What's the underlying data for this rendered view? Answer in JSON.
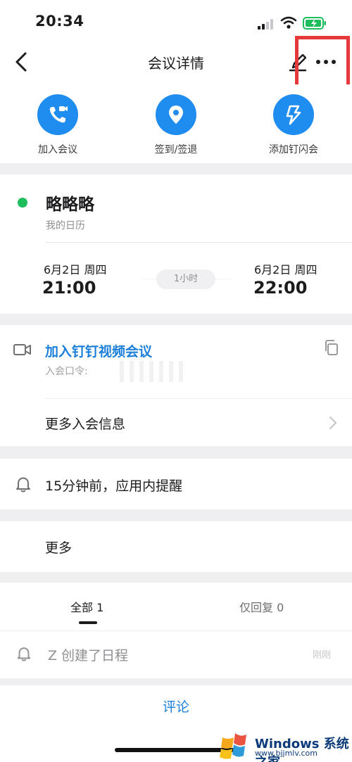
{
  "status_bar": {
    "time": "20:34"
  },
  "nav": {
    "title": "会议详情"
  },
  "actions": [
    {
      "label": "加入会议",
      "icon": "phone-video-icon"
    },
    {
      "label": "签到/签退",
      "icon": "location-pin-icon"
    },
    {
      "label": "添加钉闪会",
      "icon": "lightning-icon"
    }
  ],
  "event": {
    "title": "略略略",
    "calendar": "我的日历",
    "start_date": "6月2日 周四",
    "start_time": "21:00",
    "end_date": "6月2日 周四",
    "end_time": "22:00",
    "duration": "1小时"
  },
  "meeting": {
    "join_link": "加入钉钉视频会议",
    "password_label": "入会口令:",
    "more_info": "更多入会信息"
  },
  "reminder": {
    "text": "15分钟前，应用内提醒"
  },
  "more": {
    "label": "更多"
  },
  "tabs": {
    "all": "全部 1",
    "reply": "仅回复 0"
  },
  "activity": {
    "text": "Z 创建了日程",
    "time": "刚刚"
  },
  "comment": {
    "label": "评论"
  },
  "watermark": {
    "brand": "Windows 系统之家",
    "url": "www.bjjmlv.com"
  },
  "colors": {
    "accent": "#1f8cf0",
    "link": "#1b7fd9",
    "dot": "#1dbd5c",
    "highlight": "#e5383b"
  }
}
